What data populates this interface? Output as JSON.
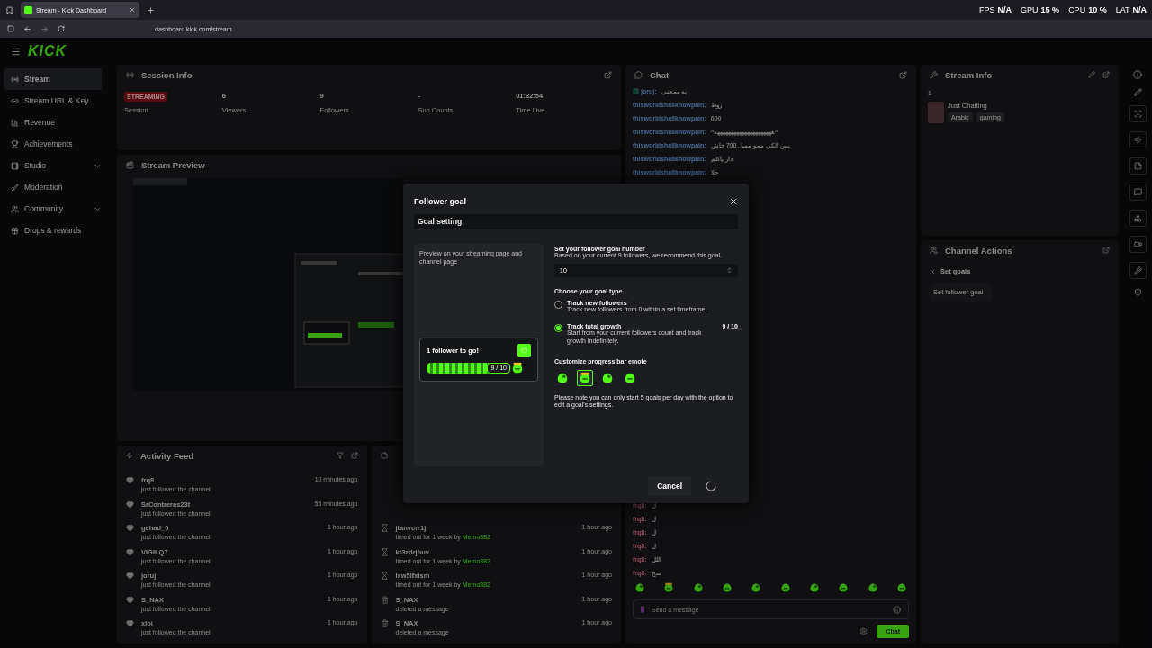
{
  "browser": {
    "tab_title": "Stream - Kick Dashboard",
    "url": "dashboard.kick.com/stream"
  },
  "perf_overlay": [
    {
      "label": "FPS",
      "value": "N/A"
    },
    {
      "label": "GPU",
      "value": "15 %"
    },
    {
      "label": "CPU",
      "value": "10 %"
    },
    {
      "label": "LAT",
      "value": "N/A"
    }
  ],
  "logo": "KICK",
  "sidebar": {
    "items": [
      {
        "label": "Stream",
        "selected": true,
        "expandable": false
      },
      {
        "label": "Stream URL & Key",
        "selected": false,
        "expandable": false
      },
      {
        "label": "Revenue",
        "selected": false,
        "expandable": false
      },
      {
        "label": "Achievements",
        "selected": false,
        "expandable": false
      },
      {
        "label": "Studio",
        "selected": false,
        "expandable": true
      },
      {
        "label": "Moderation",
        "selected": false,
        "expandable": false
      },
      {
        "label": "Community",
        "selected": false,
        "expandable": true
      },
      {
        "label": "Drops & rewards",
        "selected": false,
        "expandable": false
      }
    ]
  },
  "session_info": {
    "title": "Session Info",
    "status": {
      "badge": "STREAMING",
      "label": "Session"
    },
    "stats": [
      {
        "value": "6",
        "label": "Viewers"
      },
      {
        "value": "9",
        "label": "Followers"
      },
      {
        "value": "-",
        "label": "Sub Counts"
      },
      {
        "value": "01:32:54",
        "label": "Time Live"
      }
    ]
  },
  "stream_preview": {
    "title": "Stream Preview"
  },
  "activity_feed": {
    "title": "Activity Feed",
    "events": [
      {
        "user": "frq8",
        "text": "just followed the channel",
        "time": "10 minutes ago"
      },
      {
        "user": "SrContreras23t",
        "text": "just followed the channel",
        "time": "55 minutes ago"
      },
      {
        "user": "gehad_0",
        "text": "just followed the channel",
        "time": "1 hour ago"
      },
      {
        "user": "VIGILQ7",
        "text": "just followed the channel",
        "time": "1 hour ago"
      },
      {
        "user": "joruj",
        "text": "just followed the channel",
        "time": "1 hour ago"
      },
      {
        "user": "S_NAX",
        "text": "just followed the channel",
        "time": "1 hour ago"
      },
      {
        "user": "xloi",
        "text": "just followed the channel",
        "time": "1 hour ago"
      }
    ]
  },
  "mod_log": {
    "entries": [
      {
        "kind": "timeout",
        "user": "jtanvcrr1j",
        "action": "timed out for 1 week by",
        "moderator": "Memo882",
        "time": "1 hour ago"
      },
      {
        "kind": "timeout",
        "user": "kt3zdrjhuv",
        "action": "timed out for 1 week by",
        "moderator": "Memo882",
        "time": "1 hour ago"
      },
      {
        "kind": "timeout",
        "user": "lxw5lfxism",
        "action": "timed out for 1 week by",
        "moderator": "Memo882",
        "time": "1 hour ago"
      },
      {
        "kind": "delete",
        "user": "S_NAX",
        "action": "deleted a message",
        "time": "1 hour ago"
      },
      {
        "kind": "delete",
        "user": "S_NAX",
        "action": "deleted a message",
        "time": "1 hour ago"
      }
    ]
  },
  "chat": {
    "title": "Chat",
    "messages_top": [
      {
        "user": "joruj:",
        "text": "يه ممحني",
        "badge": true
      },
      {
        "user": "thisworldshallknowpain:",
        "text": "زوط",
        "badge": false
      },
      {
        "user": "thisworldshallknowpain:",
        "text": "600",
        "badge": false
      },
      {
        "user": "thisworldshallknowpain:",
        "text": "^هههههههههههههههههههههه^",
        "badge": false
      },
      {
        "user": "thisworldshallknowpain:",
        "text": "بس الكي ممو مميل 700 خاش",
        "badge": false
      },
      {
        "user": "thisworldshallknowpain:",
        "text": "دار ياكلم",
        "badge": false
      },
      {
        "user": "thisworldshallknowpain:",
        "text": "حلا",
        "badge": false
      }
    ],
    "messages_bottom": [
      {
        "user": "frq8:",
        "text": "ل",
        "badge": false
      },
      {
        "user": "frq8:",
        "text": "ل",
        "badge": false
      },
      {
        "user": "frq8:",
        "text": "ل",
        "badge": false
      },
      {
        "user": "frq8:",
        "text": "ل",
        "badge": false
      },
      {
        "user": "frq8:",
        "text": "اللل",
        "badge": false
      },
      {
        "user": "frq8:",
        "text": "سح",
        "badge": false
      }
    ],
    "input_placeholder": "Send a message",
    "send_button": "Chat"
  },
  "stream_info": {
    "title": "Stream Info",
    "viewer_line": "1",
    "category": "Just Chatting",
    "tags": [
      "Arabic",
      "gaming"
    ]
  },
  "channel_actions": {
    "title": "Channel Actions",
    "back": "Set goals",
    "items": [
      "Set follower goal"
    ]
  },
  "modal": {
    "title": "Follower goal",
    "section": "Goal setting",
    "preview_caption": "Preview on your streaming page and channel page",
    "preview_card": {
      "headline": "1 follower to go!",
      "level": 0.9,
      "reading": "9 / 10"
    },
    "goal_number": {
      "label": "Set your follower goal number",
      "hint": "Based on your current 9 followers, we recommend this goal.",
      "value": "10"
    },
    "goal_type": {
      "label": "Choose your goal type",
      "options": [
        {
          "title": "Track new followers",
          "description": "Track new followers from 0 within a set timeframe.",
          "selected": false
        },
        {
          "title": "Track total growth",
          "description": "Start from your current followers count and track growth indefinitely.",
          "selected": true,
          "reading": "9 / 10"
        }
      ]
    },
    "emotes": {
      "label": "Customize progress bar emote",
      "items": [
        {
          "selected": false
        },
        {
          "selected": true
        },
        {
          "selected": false
        },
        {
          "selected": false
        }
      ]
    },
    "note": "Please note you can only start 5 goals per day with the option to edit a goal's settings.",
    "cancel": "Cancel",
    "saving": true
  }
}
